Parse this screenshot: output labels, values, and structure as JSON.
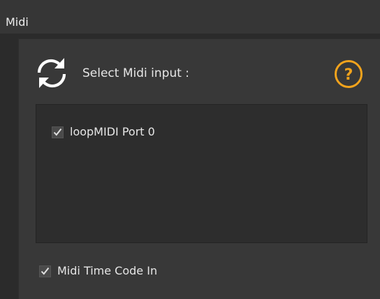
{
  "section": {
    "title": "Midi"
  },
  "midi_input": {
    "label": "Select Midi input :",
    "refresh_icon": "refresh-icon",
    "help_icon": "question-circle-icon",
    "help_glyph": "?",
    "accent_color": "#f2a31c",
    "ports": [
      {
        "label": "loopMIDI Port 0",
        "checked": true
      }
    ]
  },
  "midi_time_code": {
    "label": "Midi Time Code In",
    "checked": true
  }
}
